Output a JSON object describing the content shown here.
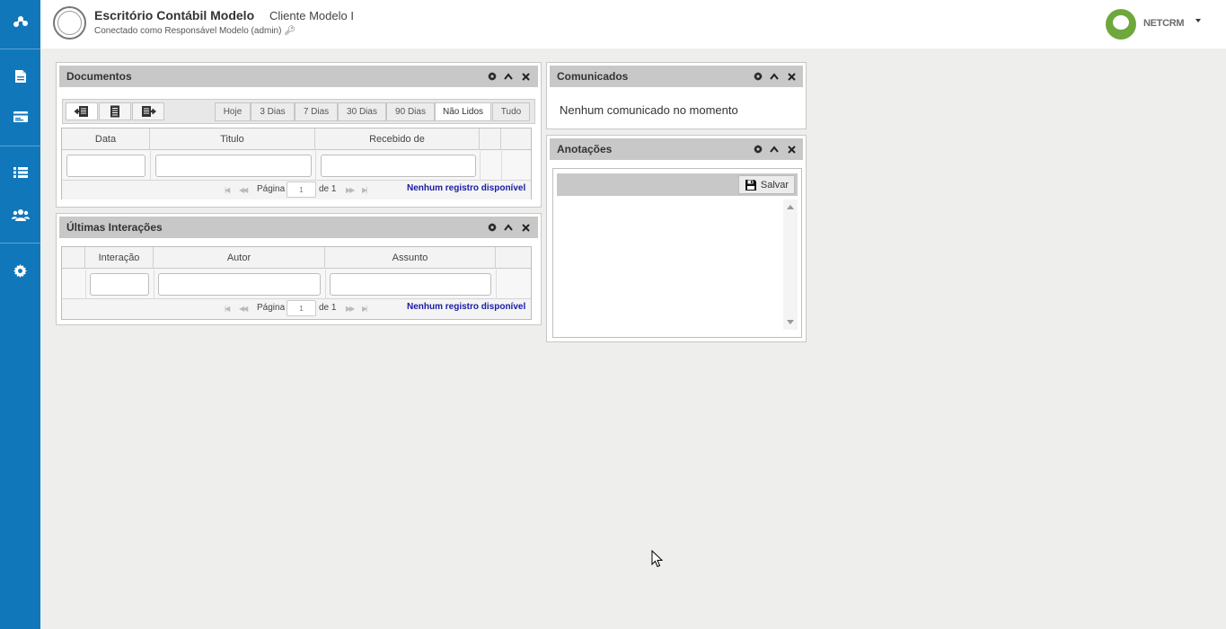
{
  "header": {
    "company": "Escritório Contábil Modelo",
    "client": "Cliente Modelo I",
    "connected": "Conectado como Responsável Modelo (admin)",
    "brand_name": "NETCRM"
  },
  "sidebar": {
    "items": [
      {
        "icon": "logo-icon"
      },
      {
        "icon": "document-icon"
      },
      {
        "icon": "card-icon"
      },
      {
        "icon": "list-icon"
      },
      {
        "icon": "users-icon"
      },
      {
        "icon": "gear-icon"
      }
    ]
  },
  "documentos": {
    "title": "Documentos",
    "filters": [
      "Hoje",
      "3 Dias",
      "7 Dias",
      "30 Dias",
      "90 Dias",
      "Não Lidos",
      "Tudo"
    ],
    "selected_filter": "Não Lidos",
    "columns": [
      "Data",
      "Titulo",
      "Recebido de"
    ],
    "pager": {
      "page_label": "Página",
      "page_value": "1",
      "of_label": "de 1",
      "empty": "Nenhum registro disponível"
    }
  },
  "interacoes": {
    "title": "Últimas Interações",
    "columns": [
      "Interação",
      "Autor",
      "Assunto"
    ],
    "pager": {
      "page_label": "Página",
      "page_value": "1",
      "of_label": "de 1",
      "empty": "Nenhum registro disponível"
    }
  },
  "comunicados": {
    "title": "Comunicados",
    "message": "Nenhum comunicado no momento"
  },
  "anotacoes": {
    "title": "Anotações",
    "save_label": "Salvar"
  },
  "colors": {
    "sidebar": "#1177bb",
    "panel_header": "#c8c8c8",
    "pager_empty": "#1a1aa6",
    "brand_green": "#6ea83c"
  }
}
